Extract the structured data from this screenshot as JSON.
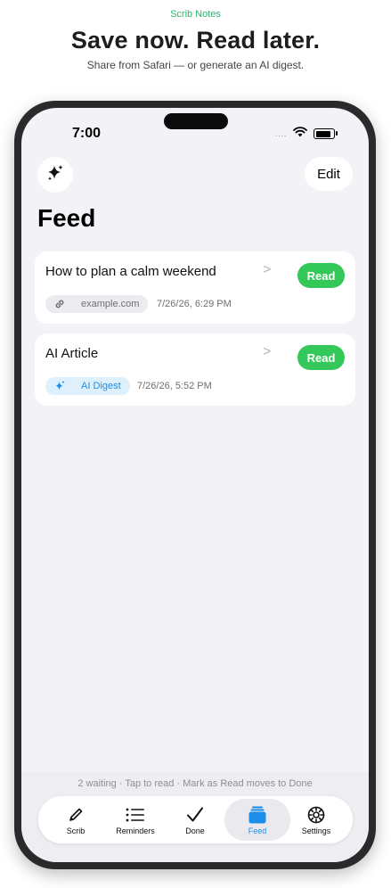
{
  "promo": {
    "brand": "Scrib Notes",
    "headline": "Save now. Read later.",
    "subheadline": "Share from Safari — or generate an AI digest."
  },
  "status_bar": {
    "time": "7:00",
    "signal": "....",
    "battery_level": 0.9
  },
  "header": {
    "edit_label": "Edit",
    "page_title": "Feed"
  },
  "feed": {
    "items": [
      {
        "title": "How to plan a calm weekend",
        "chevron": ">",
        "source": "example.com",
        "source_icon": "link-icon",
        "timestamp": "7/26/26, 6:29 PM",
        "action": "Read"
      },
      {
        "title": "AI Article",
        "chevron": ">",
        "source": "AI Digest",
        "source_icon": "sparkle-icon",
        "timestamp": "7/26/26, 5:52 PM",
        "action": "Read"
      }
    ]
  },
  "footer": {
    "hint": "2 waiting · Tap to read · Mark as Read moves to Done"
  },
  "tabs": [
    {
      "label": "Scrib",
      "icon": "pencil-icon"
    },
    {
      "label": "Reminders",
      "icon": "list-icon"
    },
    {
      "label": "Done",
      "icon": "checkmark-icon"
    },
    {
      "label": "Feed",
      "icon": "tray-icon",
      "active": true
    },
    {
      "label": "Settings",
      "icon": "gear-icon"
    }
  ],
  "colors": {
    "accent_green": "#34c759",
    "accent_blue": "#1a8ee8",
    "brand_green": "#2bb673",
    "background": "#f2f2f7"
  }
}
